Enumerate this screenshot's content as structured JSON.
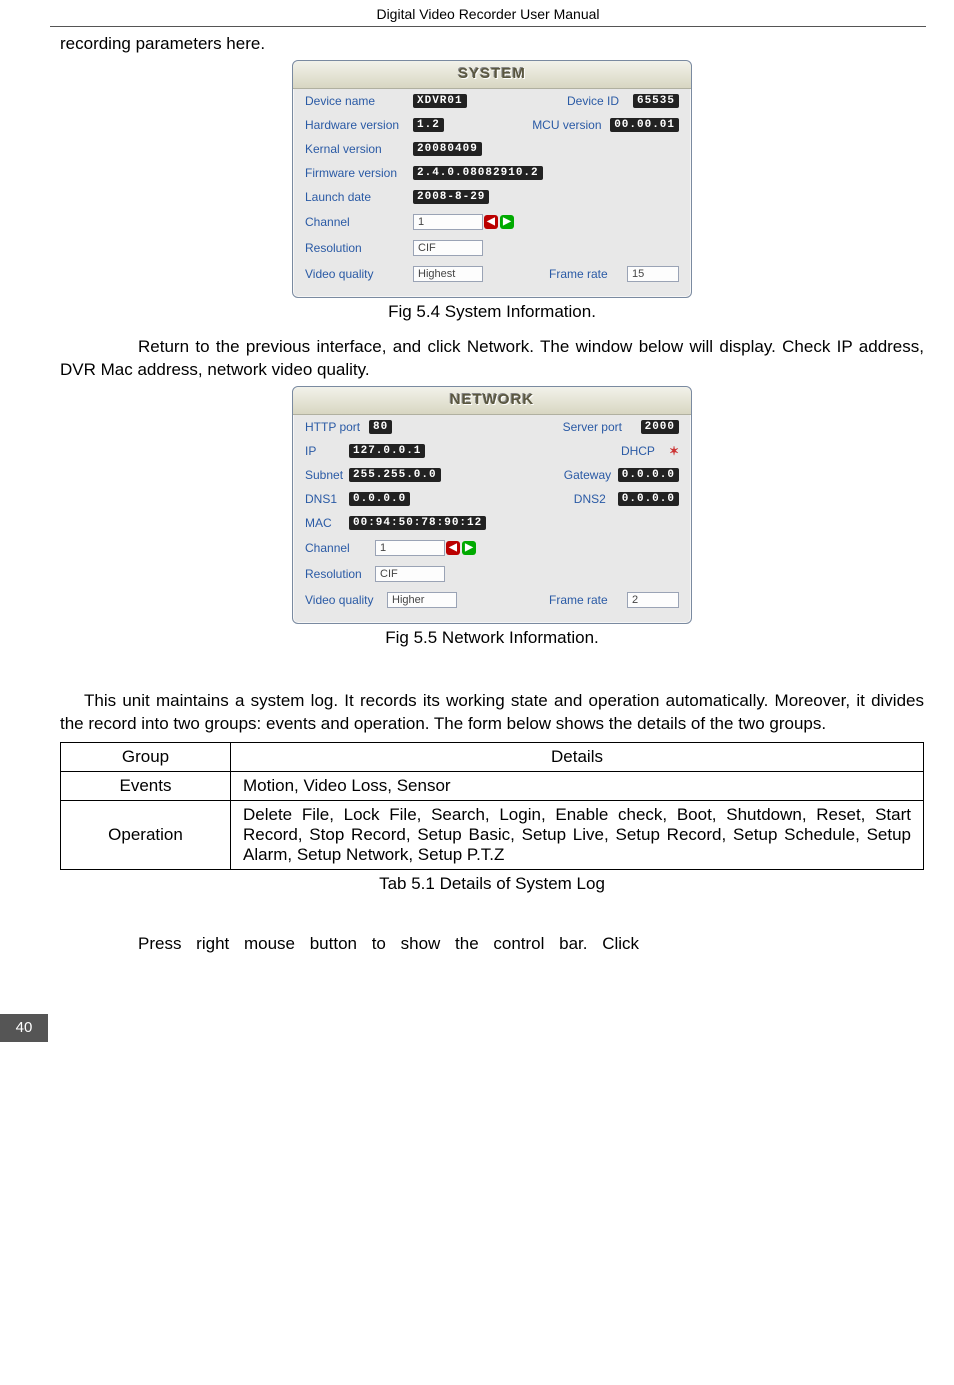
{
  "header": {
    "title": "Digital Video Recorder User Manual"
  },
  "intro": {
    "line1": "recording parameters here."
  },
  "system_panel": {
    "title": "SYSTEM",
    "device_name_label": "Device name",
    "device_name_value": "XDVR01",
    "device_id_label": "Device ID",
    "device_id_value": "65535",
    "hw_label": "Hardware version",
    "hw_value": "1.2",
    "mcu_label": "MCU version",
    "mcu_value": "00.00.01",
    "kernal_label": "Kernal version",
    "kernal_value": "20080409",
    "fw_label": "Firmware version",
    "fw_value": "2.4.0.08082910.2",
    "launch_label": "Launch date",
    "launch_value": "2008-8-29",
    "channel_label": "Channel",
    "channel_value": "1",
    "resolution_label": "Resolution",
    "resolution_value": "CIF",
    "vq_label": "Video quality",
    "vq_value": "Highest",
    "fr_label": "Frame rate",
    "fr_value": "15"
  },
  "fig54": "Fig 5.4   System Information.",
  "mid_para": "Return to the previous interface, and click Network. The window below will display. Check IP address, DVR Mac address, network video quality.",
  "network_panel": {
    "title": "NETWORK",
    "http_label": "HTTP port",
    "http_value": "80",
    "server_label": "Server port",
    "server_value": "2000",
    "ip_label": "IP",
    "ip_value": "127.0.0.1",
    "dhcp_label": "DHCP",
    "subnet_label": "Subnet",
    "subnet_value": "255.255.0.0",
    "gateway_label": "Gateway",
    "gateway_value": "0.0.0.0",
    "dns1_label": "DNS1",
    "dns1_value": "0.0.0.0",
    "dns2_label": "DNS2",
    "dns2_value": "0.0.0.0",
    "mac_label": "MAC",
    "mac_value": "00:94:50:78:90:12",
    "channel_label": "Channel",
    "channel_value": "1",
    "resolution_label": "Resolution",
    "resolution_value": "CIF",
    "vq_label": "Video quality",
    "vq_value": "Higher",
    "fr_label": "Frame rate",
    "fr_value": "2"
  },
  "fig55": "Fig 5.5   Network Information.",
  "log_intro": "This unit maintains a system log. It records its working state and operation automatically. Moreover, it divides the record into two groups: events and operation. The form below shows the details of the two groups.",
  "table": {
    "h_group": "Group",
    "h_details": "Details",
    "r1_group": "Events",
    "r1_details": "Motion, Video Loss, Sensor",
    "r2_group": "Operation",
    "r2_details": "Delete File, Lock File, Search, Login, Enable check, Boot, Shutdown, Reset, Start Record, Stop Record, Setup Basic, Setup Live, Setup Record, Setup Schedule, Setup Alarm, Setup Network, Setup P.T.Z"
  },
  "tab51": "Tab 5.1 Details of System Log",
  "final": "Press right mouse button to show the control bar. Click",
  "page_number": "40"
}
